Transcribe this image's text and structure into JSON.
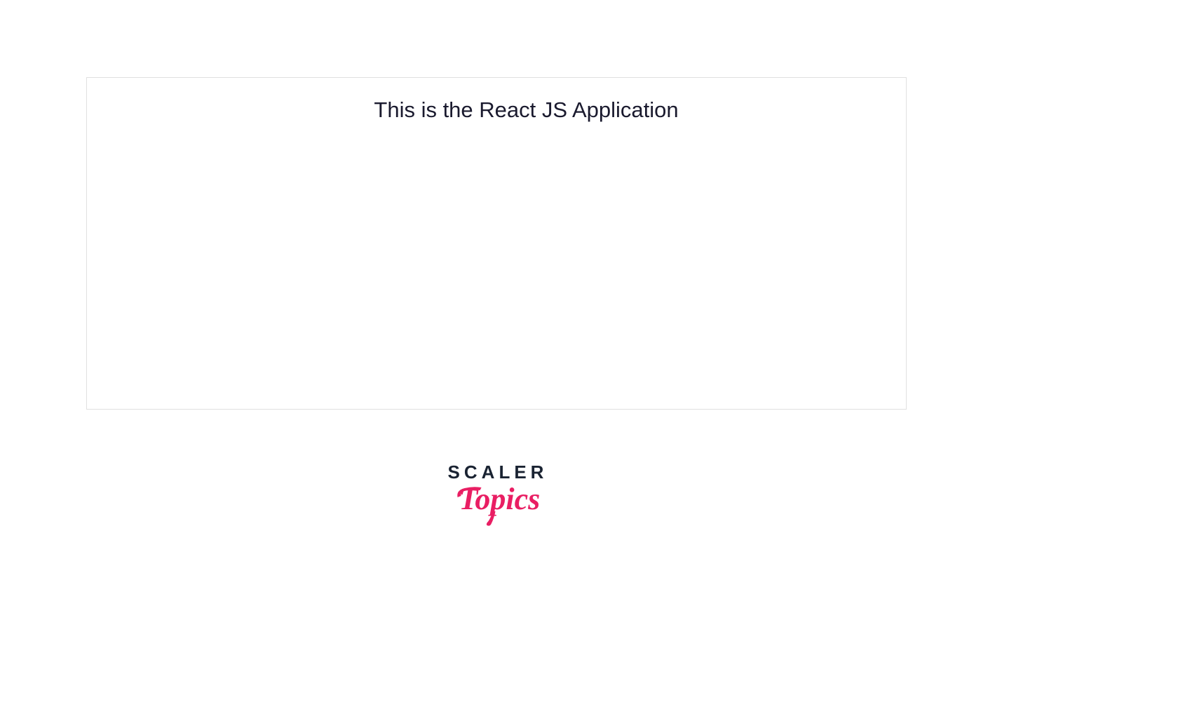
{
  "heading": "This is the React JS Application",
  "logo": {
    "line1": "SCALER",
    "line2": "Topics"
  },
  "colors": {
    "text": "#1a1a2e",
    "border": "#e0e0e0",
    "logo_dark": "#1a2332",
    "logo_pink": "#e91e63"
  }
}
